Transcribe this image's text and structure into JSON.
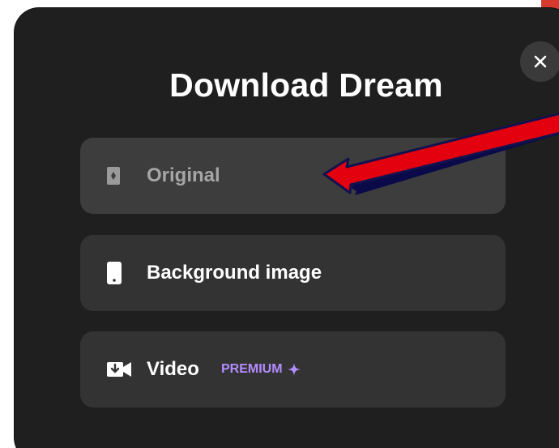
{
  "modal": {
    "title": "Download Dream",
    "close_icon": "close-icon",
    "options": [
      {
        "label": "Original",
        "icon": "original-image-icon",
        "state": "selected"
      },
      {
        "label": "Background image",
        "icon": "phone-icon"
      },
      {
        "label": "Video",
        "icon": "video-download-icon",
        "badge": "PREMIUM",
        "badge_icon": "sparkle-icon"
      }
    ]
  },
  "colors": {
    "modal_bg": "#1f1f1f",
    "option_bg": "#333333",
    "option_selected_bg": "#3d3d3d",
    "premium": "#b48cff",
    "annotation_arrow": "#e3000f"
  }
}
